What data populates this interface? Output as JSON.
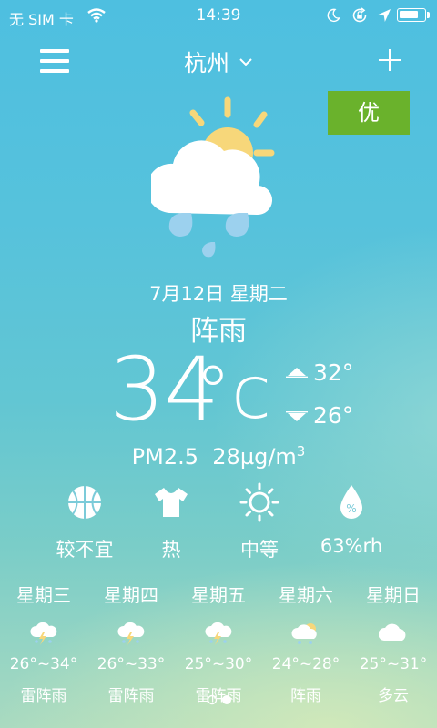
{
  "status": {
    "carrier": "无 SIM 卡",
    "time": "14:39",
    "battery_level": 0.8
  },
  "topbar": {
    "city": "杭州",
    "aqi_label": "优"
  },
  "current": {
    "date": "7月12日 星期二",
    "condition": "阵雨",
    "temp": "34",
    "unit": "°c",
    "high": "32°",
    "low": "26°",
    "pm25_label": "PM2.5",
    "pm25_value": "28µg/m",
    "pm25_exp": "3"
  },
  "indices": [
    {
      "icon": "basketball-icon",
      "label": "较不宜"
    },
    {
      "icon": "shirt-icon",
      "label": "热"
    },
    {
      "icon": "sun-uv-icon",
      "label": "中等"
    },
    {
      "icon": "humidity-drop-icon",
      "label": "63%rh"
    }
  ],
  "forecast": [
    {
      "day": "星期三",
      "range": "26°~34°",
      "condition": "雷阵雨",
      "icon": "thunderstorm-icon"
    },
    {
      "day": "星期四",
      "range": "26°~33°",
      "condition": "雷阵雨",
      "icon": "thunderstorm-icon"
    },
    {
      "day": "星期五",
      "range": "25°~30°",
      "condition": "雷阵雨",
      "icon": "thunderstorm-icon"
    },
    {
      "day": "星期六",
      "range": "24°~28°",
      "condition": "阵雨",
      "icon": "shower-icon"
    },
    {
      "day": "星期日",
      "range": "25°~31°",
      "condition": "多云",
      "icon": "cloudy-icon"
    }
  ],
  "pager": {
    "count": 2,
    "active": 1
  },
  "colors": {
    "aqi_good": "#6ab22c",
    "sun": "#f7d77a",
    "rain_drop": "#9cd1ee"
  }
}
